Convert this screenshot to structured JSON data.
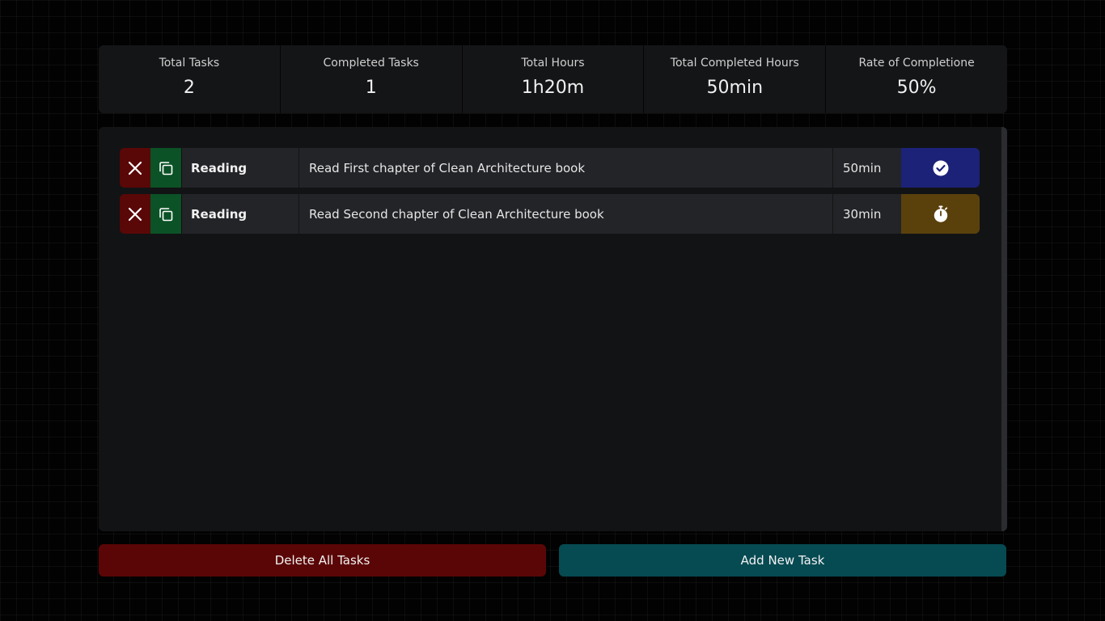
{
  "stats": [
    {
      "label": "Total Tasks",
      "value": "2"
    },
    {
      "label": "Completed Tasks",
      "value": "1"
    },
    {
      "label": "Total Hours",
      "value": "1h20m"
    },
    {
      "label": "Total Completed Hours",
      "value": "50min"
    },
    {
      "label": "Rate of Completione",
      "value": "50%"
    }
  ],
  "tasks": [
    {
      "category": "Reading",
      "description": "Read First chapter of Clean Architecture book",
      "duration": "50min",
      "status": "completed",
      "status_icon": "check-circle-icon"
    },
    {
      "category": "Reading",
      "description": "Read Second chapter of Clean Architecture book",
      "duration": "30min",
      "status": "pending",
      "status_icon": "stopwatch-icon"
    }
  ],
  "actions": {
    "delete_all_label": "Delete All Tasks",
    "add_new_label": "Add New Task"
  },
  "colors": {
    "delete": "#5a0707",
    "copy": "#0b5226",
    "completed": "#1c2278",
    "pending": "#5a410c",
    "add": "#064a52"
  }
}
